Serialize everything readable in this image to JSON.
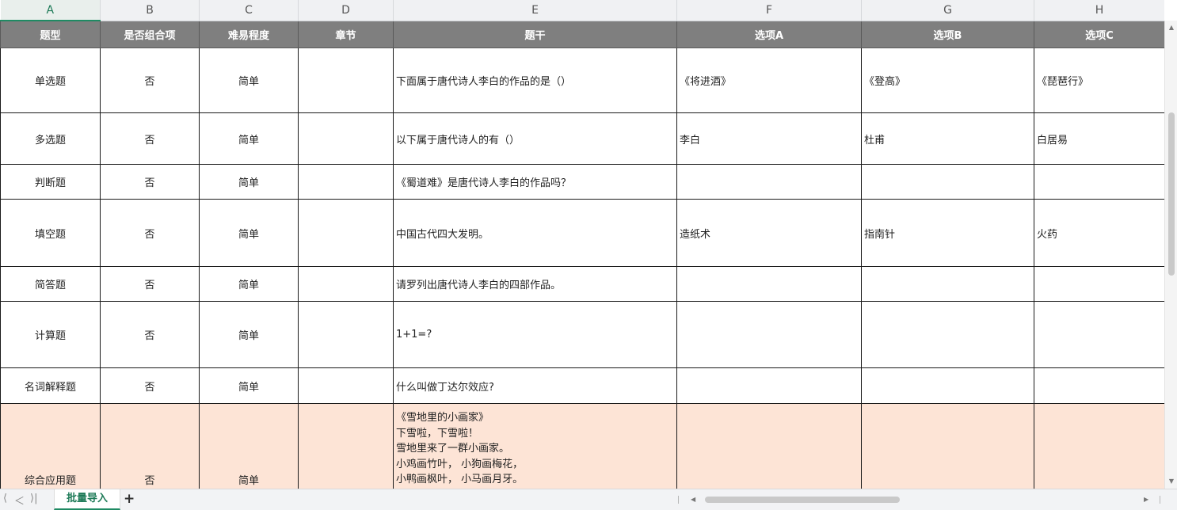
{
  "columns": [
    "A",
    "B",
    "C",
    "D",
    "E",
    "F",
    "G",
    "H"
  ],
  "headers": [
    "题型",
    "是否组合项",
    "难易程度",
    "章节",
    "题干",
    "选项A",
    "选项B",
    "选项C"
  ],
  "rows": [
    [
      "单选题",
      "否",
      "简单",
      "",
      "下面属于唐代诗人李白的作品的是（）",
      "《将进酒》",
      "《登高》",
      "《琵琶行》"
    ],
    [
      "多选题",
      "否",
      "简单",
      "",
      "以下属于唐代诗人的有（）",
      "李白",
      "杜甫",
      "白居易"
    ],
    [
      "判断题",
      "否",
      "简单",
      "",
      "《蜀道难》是唐代诗人李白的作品吗？",
      "",
      "",
      ""
    ],
    [
      "填空题",
      "否",
      "简单",
      "",
      "中国古代四大发明。",
      "造纸术",
      "指南针",
      "火药"
    ],
    [
      "简答题",
      "否",
      "简单",
      "",
      "请罗列出唐代诗人李白的四部作品。",
      "",
      "",
      ""
    ],
    [
      "计算题",
      "否",
      "简单",
      "",
      "1+1=?",
      "",
      "",
      ""
    ],
    [
      "名词解释题",
      "否",
      "简单",
      "",
      "什么叫做丁达尔效应?",
      "",
      "",
      ""
    ]
  ],
  "last_row": {
    "type": "综合应用题",
    "combined": "否",
    "difficulty": "简单",
    "chapter": "",
    "stem_lines": [
      "《雪地里的小画家》",
      "下雪啦，下雪啦！",
      "雪地里来了一群小画家。",
      "小鸡画竹叶， 小狗画梅花，",
      "小鸭画枫叶， 小马画月牙。"
    ],
    "a": "",
    "b": "",
    "c": ""
  },
  "sheet_tab": "批量导入",
  "nav": {
    "first": "⟨",
    "prev": "＜",
    "next": "＞",
    "last": "⟩|"
  },
  "add_sheet": "+",
  "colors": {
    "header_bg": "#7f7f7f",
    "highlight_row": "#fde4d6",
    "accent": "#1f8a63"
  }
}
